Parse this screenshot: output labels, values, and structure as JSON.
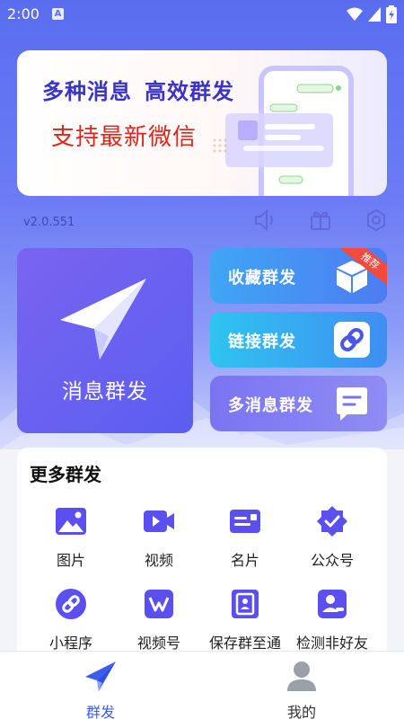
{
  "status_bar": {
    "time": "2:00",
    "indicator": "A"
  },
  "banner": {
    "headline_1": "多种消息",
    "headline_2": "高效群发",
    "subline": "支持最新微信",
    "chat_bubble_1": "",
    "chat_bubble_2": ""
  },
  "version": "v2.0.551",
  "quick_actions": [
    {
      "icon": "speaker-icon"
    },
    {
      "icon": "gift-icon"
    },
    {
      "icon": "settings-icon"
    }
  ],
  "main_card": {
    "label": "消息群发",
    "icon": "paper-plane-icon"
  },
  "side_cards": [
    {
      "label": "收藏群发",
      "icon": "box-icon",
      "badge": "推荐"
    },
    {
      "label": "链接群发",
      "icon": "link-icon"
    },
    {
      "label": "多消息群发",
      "icon": "message-icon"
    }
  ],
  "more": {
    "title": "更多群发",
    "items": [
      {
        "label": "图片",
        "icon": "image-icon"
      },
      {
        "label": "视频",
        "icon": "video-icon"
      },
      {
        "label": "名片",
        "icon": "card-icon"
      },
      {
        "label": "公众号",
        "icon": "badge-check-icon"
      },
      {
        "label": "小程序",
        "icon": "mini-program-icon"
      },
      {
        "label": "视频号",
        "icon": "channels-icon"
      },
      {
        "label": "保存群至通",
        "icon": "contacts-icon"
      },
      {
        "label": "检测非好友",
        "icon": "user-check-icon"
      }
    ]
  },
  "tabbar": {
    "tabs": [
      {
        "label": "群发",
        "icon": "paper-plane-icon",
        "active": true
      },
      {
        "label": "我的",
        "icon": "person-icon",
        "active": false
      }
    ]
  },
  "colors": {
    "primary": "#5a5ef0",
    "active_tab": "#3a5cf0",
    "inactive_tab": "#333333",
    "icon_accent": "#5b4ff0",
    "banner_red": "#e0241c",
    "banner_blue": "#3a34c8",
    "badge_red": "#f24a3c"
  }
}
